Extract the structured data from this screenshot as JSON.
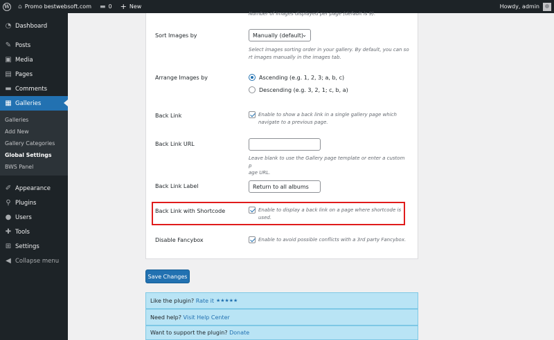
{
  "adminbar": {
    "site_name": "Promo bestwebsoft.com",
    "comments_count": "0",
    "new_label": "New",
    "howdy": "Howdy, admin"
  },
  "sidebar": {
    "items": [
      {
        "label": "Dashboard",
        "icon": "dashboard-icon"
      },
      {
        "label": "Posts",
        "icon": "pin-icon"
      },
      {
        "label": "Media",
        "icon": "media-icon"
      },
      {
        "label": "Pages",
        "icon": "pages-icon"
      },
      {
        "label": "Comments",
        "icon": "comment-icon"
      },
      {
        "label": "Galleries",
        "icon": "gallery-icon"
      }
    ],
    "submenu": [
      "Galleries",
      "Add New",
      "Gallery Categories",
      "Global Settings",
      "BWS Panel"
    ],
    "items2": [
      {
        "label": "Appearance",
        "icon": "brush-icon"
      },
      {
        "label": "Plugins",
        "icon": "plugin-icon"
      },
      {
        "label": "Users",
        "icon": "users-icon"
      },
      {
        "label": "Tools",
        "icon": "wrench-icon"
      },
      {
        "label": "Settings",
        "icon": "settings-icon"
      }
    ],
    "collapse": "Collapse menu"
  },
  "settings": {
    "top_desc": "Number of images displayed per page (default is 9).",
    "sort_label": "Sort Images by",
    "sort_value": "Manually (default)",
    "sort_desc1": "Select images sorting order in your gallery. By default, you can so",
    "sort_desc2": "rt images manually in the images tab.",
    "arrange_label": "Arrange Images by",
    "asc_label": "Ascending (e.g. 1, 2, 3; a, b, c)",
    "desc_label": "Descending (e.g. 3, 2, 1; c, b, a)",
    "backlink_label": "Back Link",
    "backlink_desc1": "Enable to show a back link in a single gallery page which",
    "backlink_desc2": "navigate to a previous page.",
    "backlink_url_label": "Back Link URL",
    "backlink_url_value": "",
    "backlink_url_desc1": "Leave blank to use the Gallery page template or enter a custom p",
    "backlink_url_desc2": "age URL.",
    "backlink_text_label": "Back Link Label",
    "backlink_text_value": "Return to all albums",
    "shortcode_label": "Back Link with Shortcode",
    "shortcode_desc1": "Enable to display a back link on a page where shortcode is",
    "shortcode_desc2": "used.",
    "fancybox_label": "Disable Fancybox",
    "fancybox_desc": "Enable to avoid possible conflicts with a 3rd party Fancybox."
  },
  "save_label": "Save Changes",
  "info": {
    "like_text": "Like the plugin?",
    "rate_link": "Rate it",
    "stars": "★★★★★",
    "help_text": "Need help?",
    "help_link": "Visit Help Center",
    "support_text": "Want to support the plugin?",
    "donate_link": "Donate"
  },
  "colors": {
    "admin_dark": "#1d2327",
    "accent": "#2271b1",
    "highlight": "#e01b1b",
    "info_bg": "#b9e4f5"
  }
}
